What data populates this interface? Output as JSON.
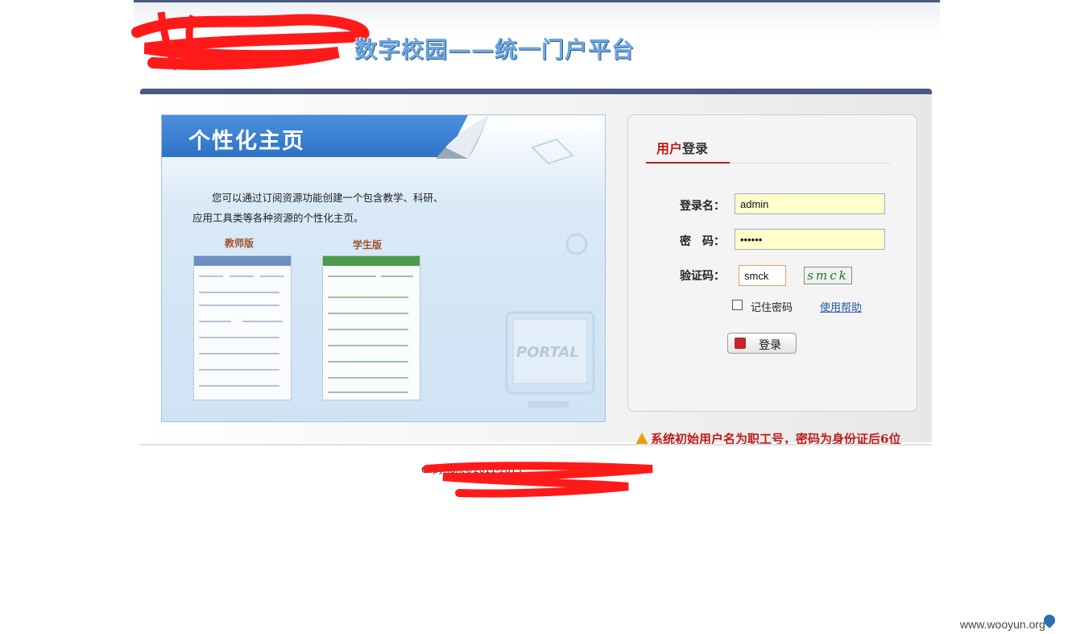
{
  "header": {
    "site_title": "数字校园——统一门户平台"
  },
  "promo": {
    "title": "个性化主页",
    "description": "您可以通过订阅资源功能创建一个包含教学、科研、应用工具类等各种资源的个性化主页。",
    "teacher_label": "教师版",
    "student_label": "学生版",
    "portal_text": "PORTAL"
  },
  "login": {
    "tab_part1": "用户",
    "tab_part2": "登录",
    "username_label": "登录名：",
    "username_value": "admin",
    "password_label": "密　码：",
    "password_value": "••••••",
    "captcha_label": "验证码：",
    "captcha_value": "smck",
    "captcha_image_text": "smck",
    "remember_label": "记住密码",
    "help_link": "使用帮助",
    "submit_label": "登录"
  },
  "notice": "系统初始用户名为职工号，密码为身份证后6位",
  "footer": {
    "copyright": "Copyright©2011-2013"
  },
  "watermark": "www.wooyun.org",
  "colors": {
    "nav_bar": "#4a5a7e",
    "accent_red": "#c31a1a",
    "input_bg": "#ffffcc",
    "banner_blue": "#2f73c8"
  }
}
